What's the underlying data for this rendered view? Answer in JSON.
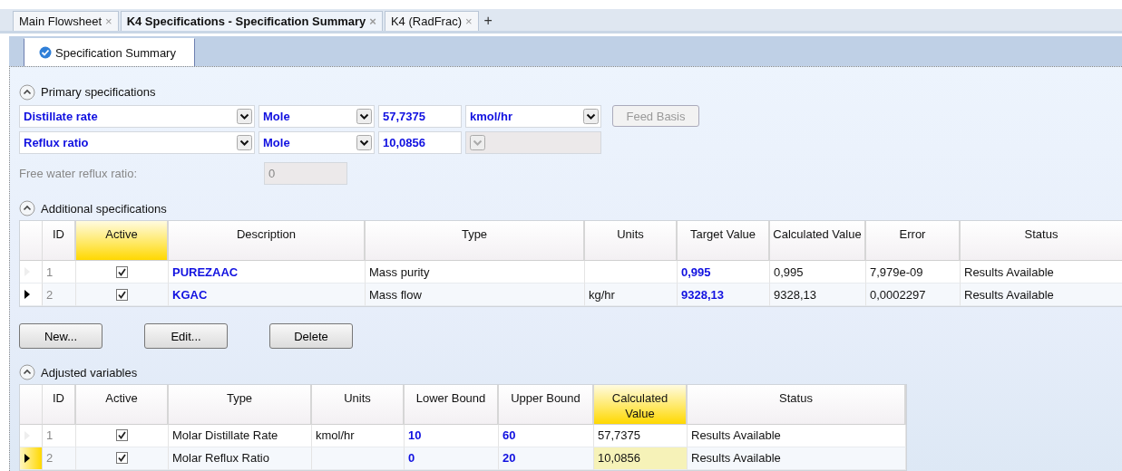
{
  "document_tabs": [
    {
      "label": "Main Flowsheet",
      "selected": false,
      "close": "×"
    },
    {
      "label": "K4 Specifications - Specification Summary",
      "selected": true,
      "close": "×"
    },
    {
      "label": "K4 (RadFrac)",
      "selected": false,
      "close": "×"
    }
  ],
  "new_tab": "+",
  "form_tabs": [
    {
      "label": "Specification Summary",
      "selected": true
    }
  ],
  "primary_specifications": {
    "title": "Primary specifications",
    "expanded": true,
    "rows": [
      {
        "spec": "Distillate rate",
        "basis": "Mole",
        "value": "57,7375",
        "units": "kmol/hr",
        "units_disabled": false
      },
      {
        "spec": "Reflux ratio",
        "basis": "Mole",
        "value": "10,0856",
        "units_disabled": true
      }
    ],
    "feed_basis": {
      "label": "Feed Basis",
      "disabled": true
    },
    "free_water": {
      "label": "Free water reflux ratio:",
      "value": "0",
      "disabled": true
    }
  },
  "additional_specifications": {
    "title": "Additional specifications",
    "expanded": true,
    "focused": false,
    "columns": [
      {
        "label": "ID",
        "kind": "id",
        "highlighted": false
      },
      {
        "label": "Active",
        "kind": "check",
        "highlighted": true
      },
      {
        "label": "Description",
        "kind": "input",
        "highlighted": false
      },
      {
        "label": "Type",
        "kind": "text",
        "highlighted": false
      },
      {
        "label": "Units",
        "kind": "text",
        "highlighted": false
      },
      {
        "label": "Target Value",
        "kind": "input",
        "highlighted": false
      },
      {
        "label": "Calculated Value",
        "kind": "text",
        "highlighted": false
      },
      {
        "label": "Error",
        "kind": "text",
        "highlighted": false
      },
      {
        "label": "Status",
        "kind": "text",
        "highlighted": false
      }
    ],
    "rows": [
      {
        "current": false,
        "cells": [
          "1",
          true,
          "PUREZAAC",
          "Mass purity",
          null,
          "0,995",
          "0,995",
          "7,979e-09",
          "Results Available"
        ]
      },
      {
        "current": true,
        "cells": [
          "2",
          true,
          "KGAC",
          "Mass flow",
          "kg/hr",
          "9328,13",
          "9328,13",
          "0,0002297",
          "Results Available"
        ]
      }
    ]
  },
  "buttons": [
    "New...",
    "Edit...",
    "Delete"
  ],
  "adjusted_variables": {
    "title": "Adjusted variables",
    "expanded": true,
    "focused": true,
    "columns": [
      {
        "label": "ID",
        "kind": "id",
        "highlighted": false
      },
      {
        "label": "Active",
        "kind": "check",
        "highlighted": false
      },
      {
        "label": "Type",
        "kind": "text",
        "highlighted": false
      },
      {
        "label": "Units",
        "kind": "text",
        "highlighted": false
      },
      {
        "label": "Lower Bound",
        "kind": "input",
        "highlighted": false
      },
      {
        "label": "Upper Bound",
        "kind": "input",
        "highlighted": false
      },
      {
        "label": "Calculated Value",
        "kind": "text",
        "highlighted": true
      },
      {
        "label": "Status",
        "kind": "text",
        "highlighted": false
      }
    ],
    "rows": [
      {
        "current": false,
        "cells": [
          "1",
          true,
          "Molar Distillate Rate",
          "kmol/hr",
          "10",
          "60",
          "57,7375",
          "Results Available"
        ]
      },
      {
        "current": true,
        "cells": [
          "2",
          true,
          "Molar Reflux Ratio",
          null,
          "0",
          "20",
          "10,0856",
          "Results Available"
        ]
      }
    ]
  }
}
